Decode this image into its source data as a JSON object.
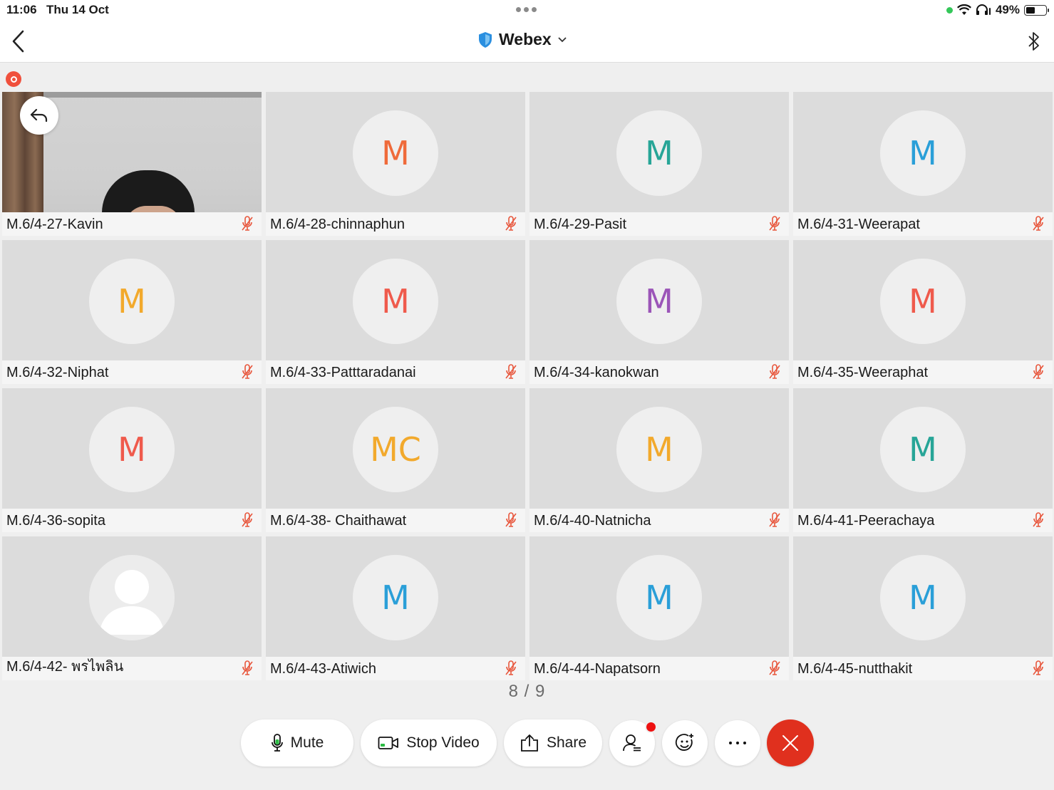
{
  "status_bar": {
    "time": "11:06",
    "date": "Thu 14 Oct",
    "battery_text": "49%",
    "battery_level": 0.49
  },
  "nav": {
    "title": "Webex",
    "icons": [
      "back-chevron-icon",
      "shield-icon",
      "chevron-down-icon",
      "bluetooth-icon"
    ]
  },
  "colors": {
    "orange": "#ef6a3a",
    "teal": "#27a597",
    "blue": "#2a9fd8",
    "amber": "#f2a92c",
    "red": "#ef5a4c",
    "purple": "#9b55b8",
    "muted_mic": "#e8563c",
    "end_call": "#e0301e"
  },
  "participants": [
    {
      "name": "M.6/4-27-Kavin",
      "initials": "",
      "video": true
    },
    {
      "name": "M.6/4-28-chinnaphun",
      "initials": "M",
      "color": "#ef6a3a"
    },
    {
      "name": "M.6/4-29-Pasit",
      "initials": "M",
      "color": "#27a597"
    },
    {
      "name": "M.6/4-31-Weerapat",
      "initials": "M",
      "color": "#2a9fd8"
    },
    {
      "name": "M.6/4-32-Niphat",
      "initials": "M",
      "color": "#f2a92c"
    },
    {
      "name": "M.6/4-33-Patttaradanai",
      "initials": "M",
      "color": "#ef5a4c"
    },
    {
      "name": "M.6/4-34-kanokwan",
      "initials": "M",
      "color": "#9b55b8"
    },
    {
      "name": "M.6/4-35-Weeraphat",
      "initials": "M",
      "color": "#ef5a4c"
    },
    {
      "name": "M.6/4-36-sopita",
      "initials": "M",
      "color": "#ef5a4c"
    },
    {
      "name": "M.6/4-38- Chaithawat",
      "initials": "MC",
      "color": "#f2a92c"
    },
    {
      "name": "M.6/4-40-Natnicha",
      "initials": "M",
      "color": "#f2a92c"
    },
    {
      "name": "M.6/4-41-Peerachaya",
      "initials": "M",
      "color": "#27a597"
    },
    {
      "name": "M.6/4-42- พรไพลิน",
      "initials": "",
      "placeholder": true
    },
    {
      "name": "M.6/4-43-Atiwich",
      "initials": "M",
      "color": "#2a9fd8"
    },
    {
      "name": "M.6/4-44-Napatsorn",
      "initials": "M",
      "color": "#2a9fd8"
    },
    {
      "name": "M.6/4-45-nutthakit",
      "initials": "M",
      "color": "#2a9fd8"
    }
  ],
  "pager": "8 / 9",
  "controls": {
    "mute_label": "Mute",
    "stop_video_label": "Stop Video",
    "share_label": "Share"
  }
}
